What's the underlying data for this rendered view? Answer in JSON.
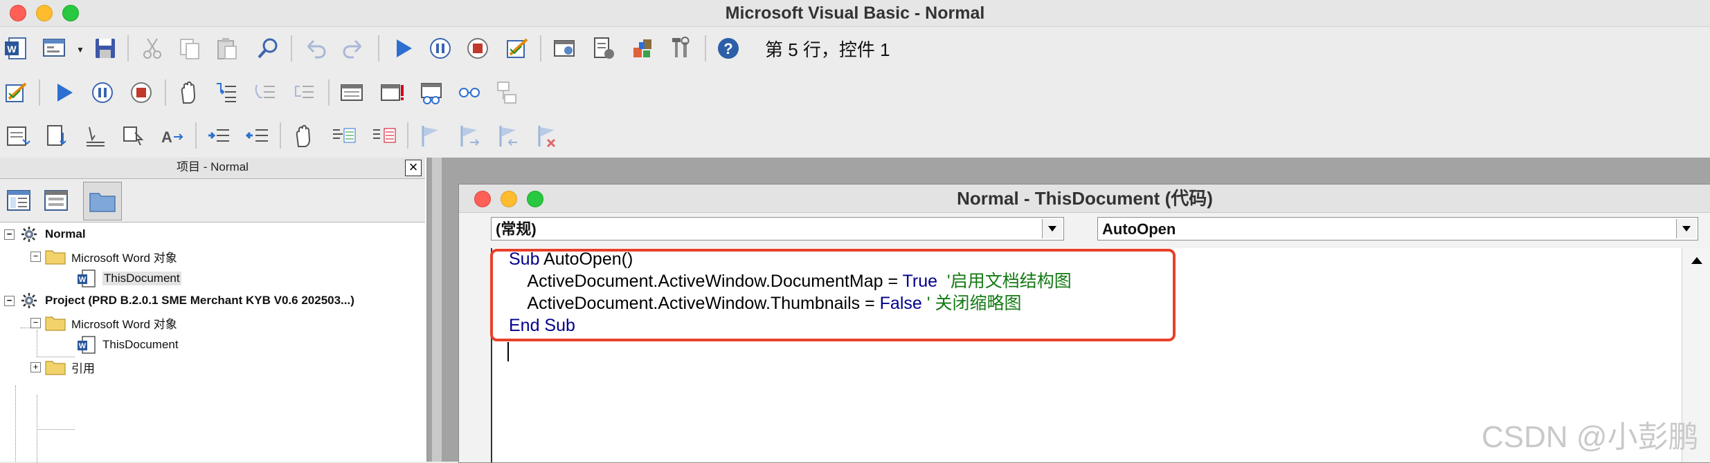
{
  "app": {
    "title": "Microsoft Visual Basic - Normal",
    "status": "第 5 行，控件 1"
  },
  "toolbar": {
    "standard": [
      "word-icon",
      "insert-userform-icon",
      "save-icon",
      "cut-icon",
      "copy-icon",
      "paste-icon",
      "find-icon",
      "undo-icon",
      "redo-icon",
      "run-icon",
      "break-icon",
      "reset-icon",
      "design-mode-icon",
      "project-explorer-icon",
      "properties-icon",
      "object-browser-icon",
      "toolbox-icon",
      "help-icon"
    ],
    "debug": [
      "design-mode-icon",
      "run-icon",
      "break-icon",
      "reset-icon",
      "toggle-breakpoint-icon",
      "step-into-icon",
      "step-over-icon",
      "step-out-icon",
      "locals-window-icon",
      "immediate-window-icon",
      "watch-window-icon",
      "quick-watch-icon",
      "call-stack-icon"
    ],
    "edit": [
      "list-properties-icon",
      "list-constants-icon",
      "quick-info-icon",
      "parameter-info-icon",
      "complete-word-icon",
      "indent-icon",
      "outdent-icon",
      "toggle-breakpoint-icon",
      "comment-block-icon",
      "uncomment-block-icon",
      "toggle-bookmark-icon",
      "next-bookmark-icon",
      "previous-bookmark-icon",
      "clear-bookmarks-icon"
    ]
  },
  "project_panel": {
    "title": "项目 - Normal",
    "close": "×",
    "tree": [
      {
        "label": "Normal",
        "level": 0,
        "expander": "−",
        "icon": "vba-project-icon",
        "bold": true
      },
      {
        "label": "Microsoft Word 对象",
        "level": 1,
        "expander": "−",
        "icon": "folder-icon"
      },
      {
        "label": "ThisDocument",
        "level": 2,
        "icon": "word-document-icon",
        "selected": true
      },
      {
        "label": "Project (PRD B.2.0.1 SME Merchant KYB V0.6 202503...)",
        "level": 0,
        "expander": "−",
        "icon": "vba-project-icon",
        "bold": true
      },
      {
        "label": "Microsoft Word 对象",
        "level": 1,
        "expander": "−",
        "icon": "folder-icon"
      },
      {
        "label": "ThisDocument",
        "level": 2,
        "icon": "word-document-icon"
      },
      {
        "label": "引用",
        "level": 1,
        "expander": "+",
        "icon": "folder-icon"
      }
    ]
  },
  "code_window": {
    "title": "Normal - ThisDocument (代码)",
    "object_combo": "(常规)",
    "procedure_combo": "AutoOpen",
    "lines": [
      {
        "indent": "",
        "parts": [
          {
            "t": "Sub",
            "c": "kw"
          },
          {
            "t": " AutoOpen()",
            "c": ""
          }
        ]
      },
      {
        "indent": "    ",
        "parts": [
          {
            "t": "ActiveDocument.ActiveWindow.DocumentMap = ",
            "c": ""
          },
          {
            "t": "True",
            "c": "kw"
          },
          {
            "t": "  '启用文档结构图",
            "c": "cm"
          }
        ]
      },
      {
        "indent": "    ",
        "parts": [
          {
            "t": "ActiveDocument.ActiveWindow.Thumbnails = ",
            "c": ""
          },
          {
            "t": "False",
            "c": "kw"
          },
          {
            "t": " ' 关闭缩略图",
            "c": "cm"
          }
        ]
      },
      {
        "indent": "",
        "parts": [
          {
            "t": "End Sub",
            "c": "kw"
          }
        ]
      }
    ]
  },
  "watermark": "CSDN @小彭鹏",
  "colors": {
    "keyword": "#00008b",
    "comment": "#137a13",
    "highlight": "#e8412a"
  }
}
